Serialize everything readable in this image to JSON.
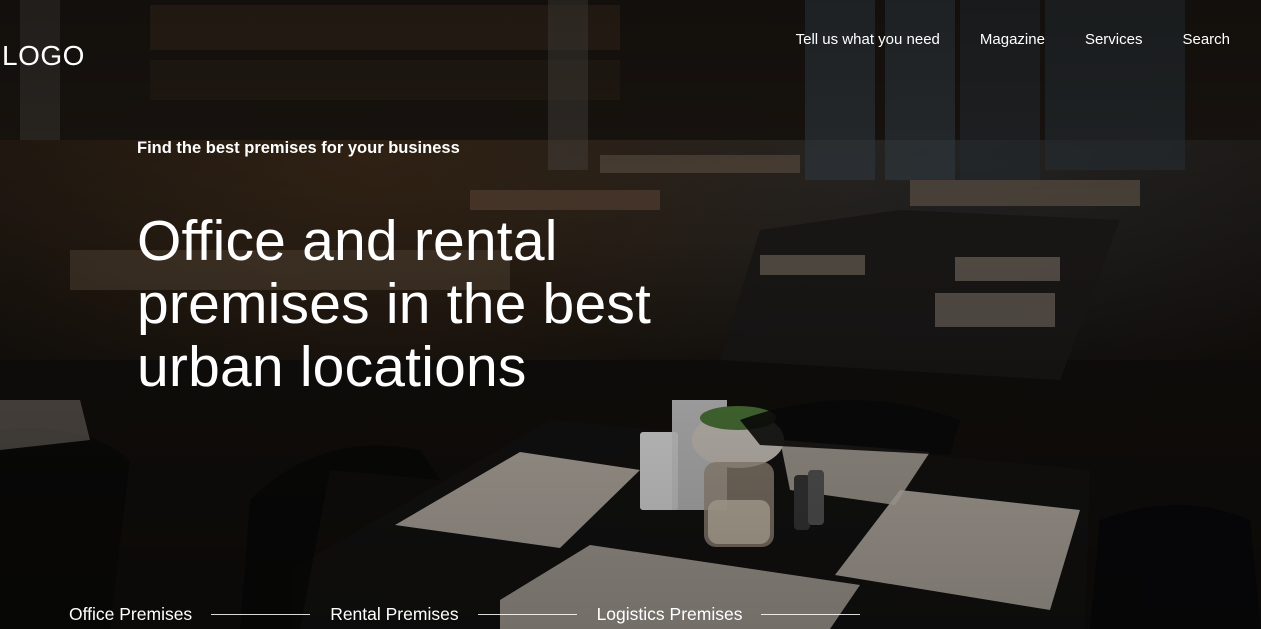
{
  "header": {
    "logo_text": "LOGO",
    "nav": [
      {
        "label": "Tell us what you need"
      },
      {
        "label": "Magazine"
      },
      {
        "label": "Services"
      },
      {
        "label": "Search"
      }
    ]
  },
  "hero": {
    "tagline": "Find the best premises for your business",
    "headline": "Office and rental premises in the best urban locations",
    "background_image": "restaurant-interior-photo"
  },
  "categories": [
    {
      "label": "Office Premises"
    },
    {
      "label": "Rental Premises"
    },
    {
      "label": "Logistics Premises"
    }
  ],
  "colors": {
    "text": "#ffffff",
    "background": "#0f0d0b"
  }
}
